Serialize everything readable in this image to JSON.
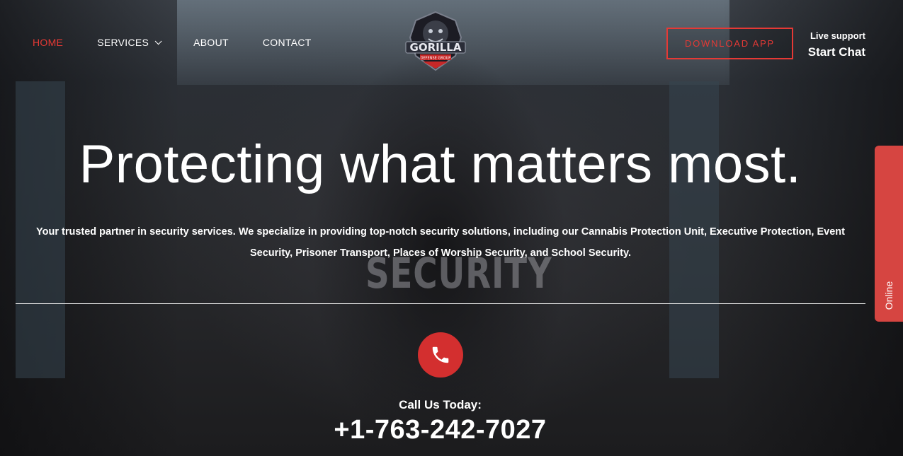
{
  "nav": {
    "home": "HOME",
    "services": "SERVICES",
    "about": "ABOUT",
    "contact": "CONTACT"
  },
  "logo": {
    "text": "GORILLA",
    "subtext": "DEFENSE GROUP"
  },
  "header": {
    "download_label": "DOWNLOAD APP",
    "live_support": "Live support",
    "start_chat": "Start Chat"
  },
  "hero": {
    "title": "Protecting what matters most.",
    "intro": "Your trusted partner in security services. We specialize in providing top-notch security solutions, including our Cannabis Protection Unit, Executive Protection, Event Security, Prisoner Transport, Places of Worship Security, and School Security.",
    "vest_text": "SECURITY"
  },
  "contact": {
    "call_label": "Call Us Today:",
    "phone": "+1-763-242-7027",
    "icon": "phone-icon"
  },
  "chat_tab": {
    "label": "Online"
  },
  "colors": {
    "accent": "#e53935",
    "phone_circle": "#d32f2f",
    "tab": "#d64541"
  }
}
